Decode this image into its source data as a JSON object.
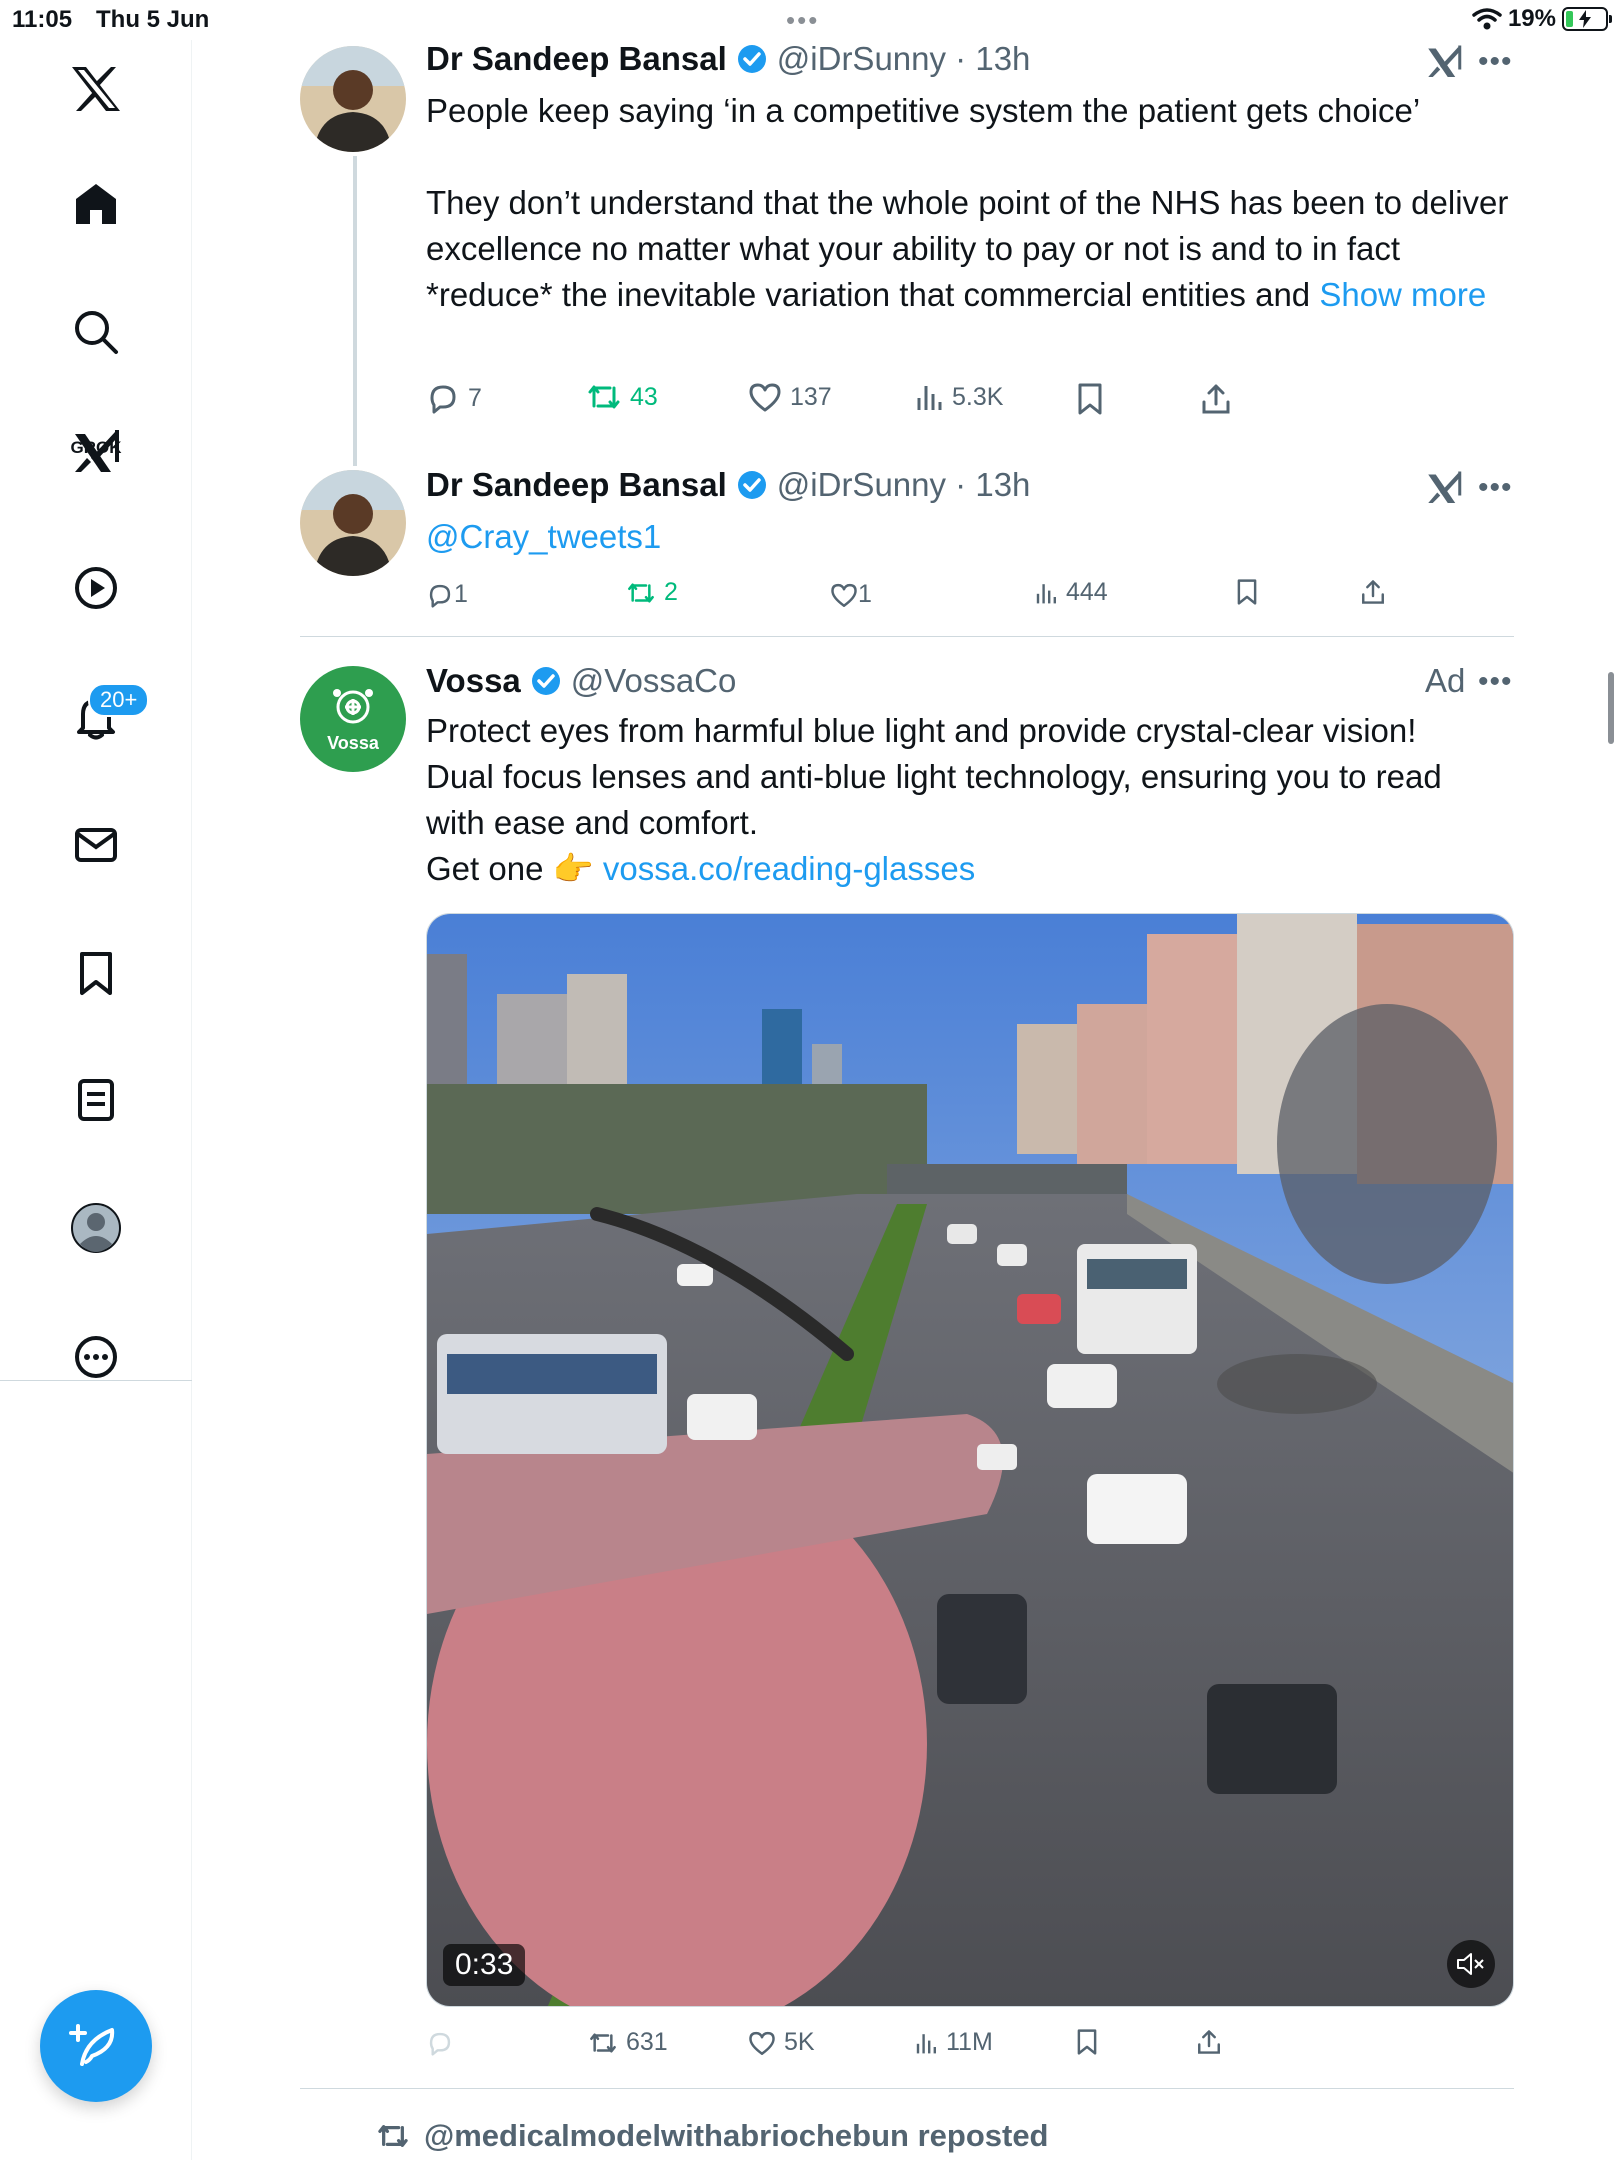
{
  "status_bar": {
    "time": "11:05",
    "date": "Thu 5 Jun",
    "battery_percent": "19%",
    "battery_level": 0.19
  },
  "sidebar": {
    "items": [
      {
        "name": "x-logo",
        "icon": "x-logo-icon"
      },
      {
        "name": "home",
        "icon": "home-icon"
      },
      {
        "name": "explore",
        "icon": "search-icon"
      },
      {
        "name": "grok",
        "icon": "grok-icon",
        "label": "GROK"
      },
      {
        "name": "video",
        "icon": "play-icon"
      },
      {
        "name": "notifications",
        "icon": "bell-icon",
        "badge": "20+"
      },
      {
        "name": "messages",
        "icon": "mail-icon"
      },
      {
        "name": "bookmarks",
        "icon": "bookmark-icon"
      },
      {
        "name": "lists",
        "icon": "list-icon"
      },
      {
        "name": "profile",
        "icon": "profile-icon"
      },
      {
        "name": "more",
        "icon": "more-circle-icon"
      }
    ],
    "compose_icon": "feather-plus-icon"
  },
  "colors": {
    "accent": "#1d9bf0",
    "retweet": "#00ba7c",
    "secondary_text": "#536471"
  },
  "tweets": [
    {
      "author": "Dr Sandeep Bansal",
      "handle": "@iDrSunny",
      "time": "13h",
      "text": "People keep saying ‘in a competitive system the patient gets choice’\n\nThey don’t understand that the whole point of the NHS has been to deliver excellence no matter what your ability to pay or not is and to in fact *reduce* the inevitable variation that commercial entities and ",
      "show_more": "Show more",
      "replies": "7",
      "retweets": "43",
      "likes": "137",
      "views": "5.3K"
    },
    {
      "author": "Dr Sandeep Bansal",
      "handle": "@iDrSunny",
      "time": "13h",
      "mention": "@Cray_tweets1",
      "replies": "1",
      "retweets": "2",
      "likes": "1",
      "views": "444"
    },
    {
      "author": "Vossa",
      "handle": "@VossaCo",
      "ad_label": "Ad",
      "avatar_text": "Vossa",
      "text_line1": "Protect eyes from harmful blue light and provide crystal-clear vision!",
      "text_line2": "Dual focus lenses and anti-blue light technology, ensuring you to read",
      "text_line3": "with ease and comfort.",
      "text_line4_prefix": "Get one ",
      "text_emoji": "👉",
      "link": "vossa.co/reading-glasses",
      "video_duration": "0:33",
      "retweets": "631",
      "likes": "5K",
      "views": "11M"
    }
  ],
  "next_item": {
    "repost_text": "@medicalmodelwithabriochebun reposted"
  }
}
